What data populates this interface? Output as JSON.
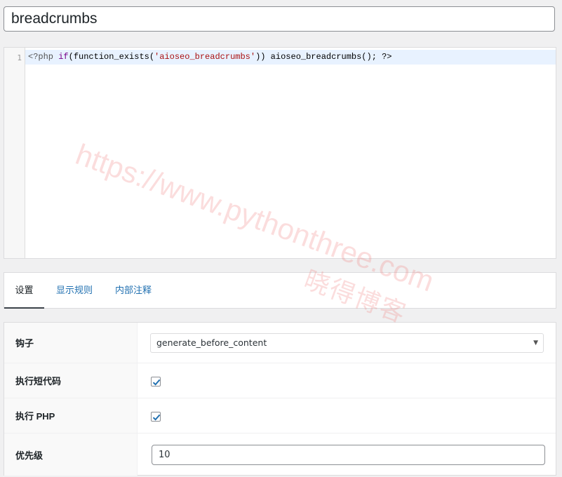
{
  "title_field": {
    "value": "breadcrumbs"
  },
  "code_editor": {
    "line_number": "1",
    "tokens": {
      "open": "<?php ",
      "keyword": "if",
      "call_open": "(function_exists(",
      "string": "'aioseo_breadcrumbs'",
      "call_close": ")) aioseo_breadcrumbs(); ?>"
    }
  },
  "tabs": [
    {
      "label": "设置",
      "active": true
    },
    {
      "label": "显示规则",
      "active": false
    },
    {
      "label": "内部注释",
      "active": false
    }
  ],
  "settings": {
    "hook": {
      "label": "钩子",
      "value": "generate_before_content"
    },
    "execute_shortcodes": {
      "label": "执行短代码",
      "checked": true
    },
    "execute_php": {
      "label": "执行 PHP",
      "checked": true
    },
    "priority": {
      "label": "优先级",
      "value": "10"
    }
  },
  "watermark": {
    "url": "https://www.pythonthree.com",
    "name": "晓得博客"
  },
  "colors": {
    "link": "#2271b1",
    "checkbox_tick": "#2271b1",
    "active_line": "#e8f2ff"
  }
}
